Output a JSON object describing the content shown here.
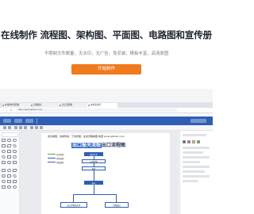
{
  "hero": {
    "title": "在线制作 流程图、架构图、平面图、电路图和宣传册",
    "subtitle": "不限制文件数量，无水印，无广告，免安装；模板丰富，高清原图",
    "cta_label": "开始制作",
    "accent_color": "#f07a1e"
  },
  "browser": {
    "tabs": [
      {
        "label": "在线制作流程图"
      },
      {
        "label": "亿图图示"
      },
      {
        "label": "出口流程图"
      },
      {
        "label": "未命名文件"
      }
    ],
    "address": "https://www.lgtbuto.com/..."
  },
  "diagram": {
    "caption": "通过制图、绘制导航、下载导图，在线流程制图·联盟 www.lgtbuto.com",
    "title_highlight": "出口报关流程",
    "title_rest": "出口流程图",
    "nodes": [
      "接收订单",
      "安排货物",
      "备货",
      "报关",
      "出口货物报关单",
      "货物装运"
    ],
    "legend": [
      "付款流程",
      "货物流程",
      "单据流程"
    ],
    "brand_color": "#2f5fb4"
  }
}
